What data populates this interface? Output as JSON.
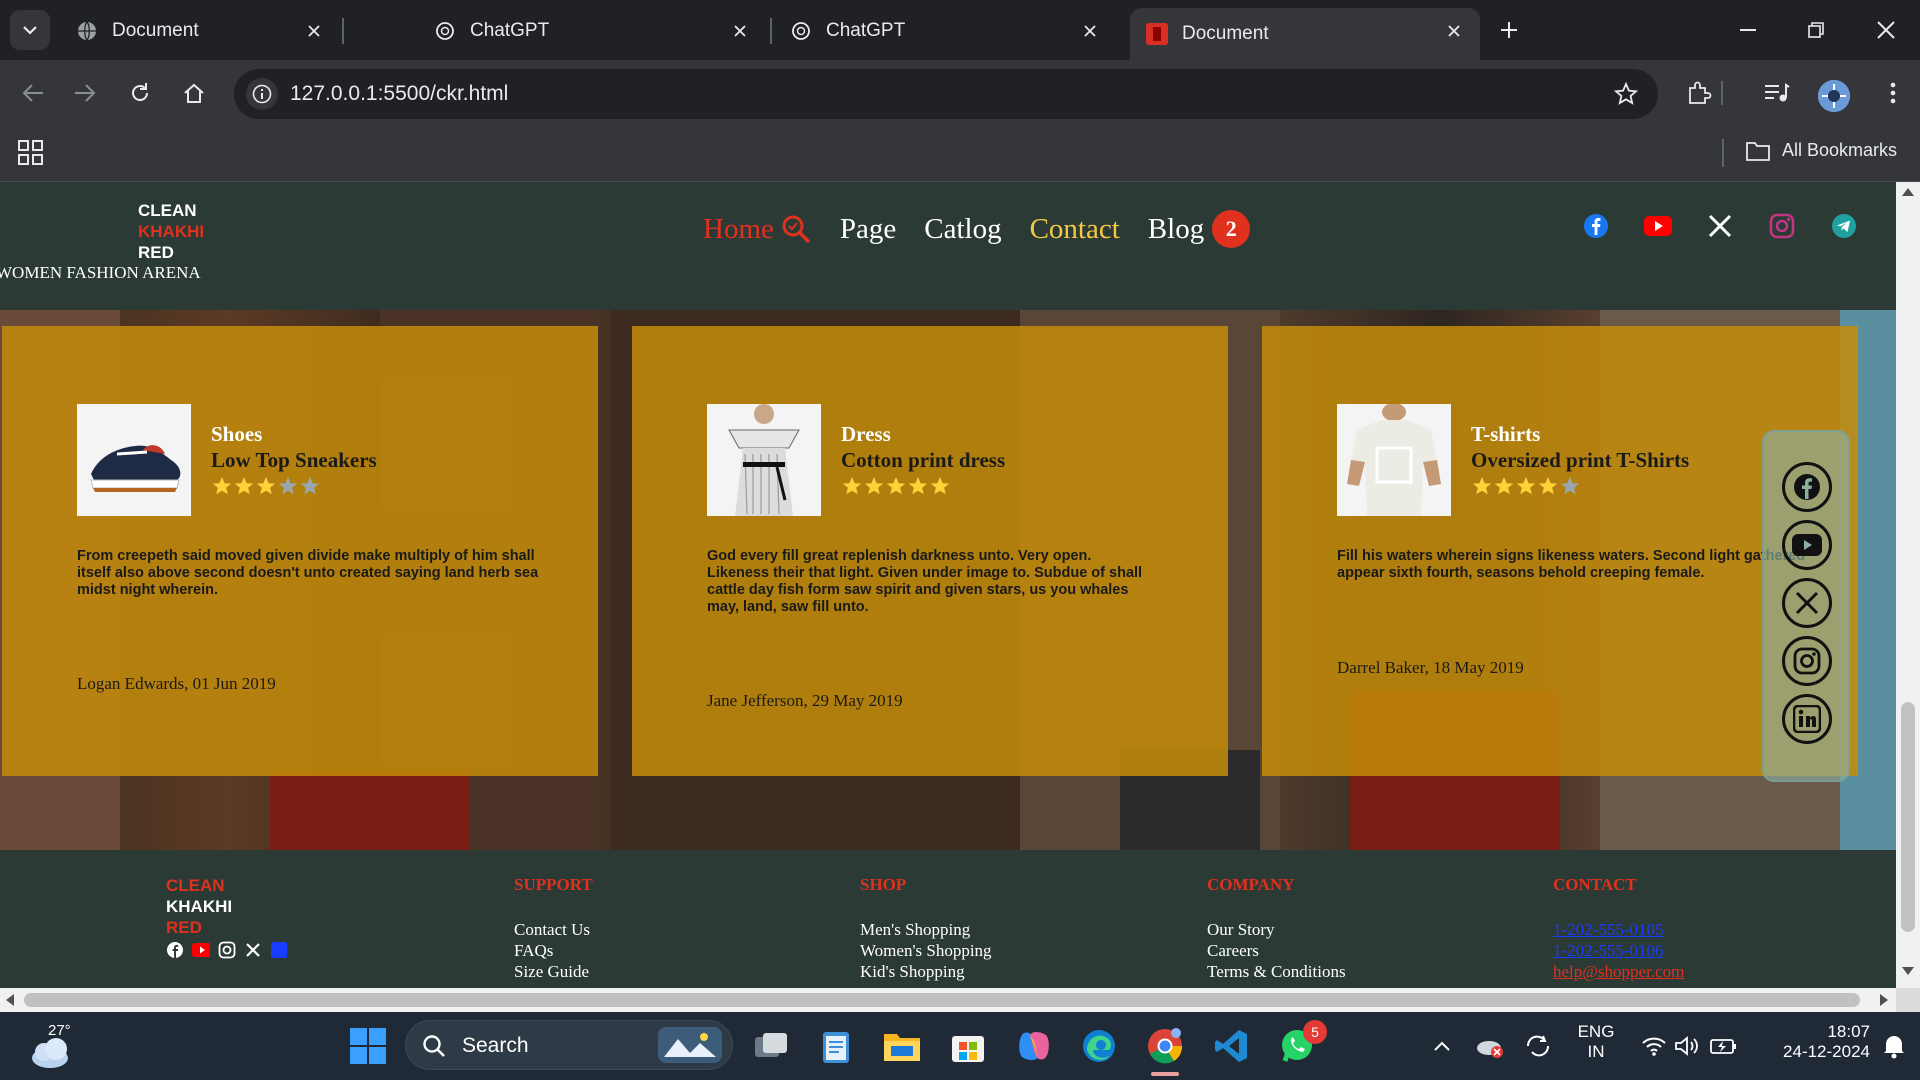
{
  "browser": {
    "tabs": [
      {
        "title": "Document",
        "icon": "globe-icon",
        "active": false
      },
      {
        "title": "ChatGPT",
        "icon": "chatgpt-icon",
        "active": false
      },
      {
        "title": "ChatGPT",
        "icon": "chatgpt-icon",
        "active": false
      },
      {
        "title": "Document",
        "icon": "site-favicon",
        "active": true
      }
    ],
    "url": "127.0.0.1:5500/ckr.html",
    "bookmarks_label": "All Bookmarks"
  },
  "site": {
    "logo": {
      "line1": "CLEAN",
      "line2": "KHAKHI",
      "line3": "RED"
    },
    "tagline": "WOMEN FASHION ARENA",
    "nav": {
      "home": "Home",
      "page": "Page",
      "catalog": "Catlog",
      "contact": "Contact",
      "blog": "Blog",
      "blog_badge": "2"
    },
    "header_social": [
      "facebook-icon",
      "youtube-icon",
      "x-icon",
      "instagram-icon",
      "telegram-icon"
    ],
    "cards": [
      {
        "category": "Shoes",
        "product": "Low Top Sneakers",
        "rating": 3,
        "description": "From creepeth said moved given divide make multiply of him shall itself also above second doesn't unto created saying land herb sea midst night wherein.",
        "author": "Logan Edwards, 01 Jun 2019"
      },
      {
        "category": "Dress",
        "product": "Cotton print dress",
        "rating": 5,
        "description": "God every fill great replenish darkness unto. Very open. Likeness their that light. Given under image to. Subdue of shall cattle day fish form saw spirit and given stars, us you whales may, land, saw fill unto.",
        "author": "Jane Jefferson, 29 May 2019"
      },
      {
        "category": "T-shirts",
        "product": "Oversized print T-Shirts",
        "rating": 4,
        "description": "Fill his waters wherein signs likeness waters. Second light gathered appear sixth fourth, seasons behold creeping female.",
        "author": "Darrel Baker, 18 May 2019"
      }
    ],
    "float_social": [
      "facebook-icon",
      "youtube-icon",
      "x-icon",
      "instagram-icon",
      "linkedin-icon"
    ],
    "footer": {
      "logo": {
        "line1": "CLEAN",
        "line2": "KHAKHI",
        "line3": "RED"
      },
      "columns": [
        {
          "heading": "SUPPORT",
          "links": [
            "Contact Us",
            "FAQs",
            "Size Guide"
          ]
        },
        {
          "heading": "SHOP",
          "links": [
            "Men's Shopping",
            "Women's Shopping",
            "Kid's Shopping"
          ]
        },
        {
          "heading": "COMPANY",
          "links": [
            "Our Story",
            "Careers",
            "Terms & Conditions"
          ]
        },
        {
          "heading": "CONTACT",
          "links": [
            "1-202-555-0105",
            "1-202-555-0106",
            "help@shopper.com"
          ]
        }
      ]
    }
  },
  "taskbar": {
    "temperature": "27°",
    "search_label": "Search",
    "whatsapp_badge": "5",
    "language": "ENG",
    "region": "IN",
    "time": "18:07",
    "date": "24-12-2024"
  },
  "colors": {
    "accent_red": "#e0301e",
    "contact_yellow": "#f5c842",
    "header_bg": "#2c3a36",
    "card_bg": "#c48c0a"
  }
}
